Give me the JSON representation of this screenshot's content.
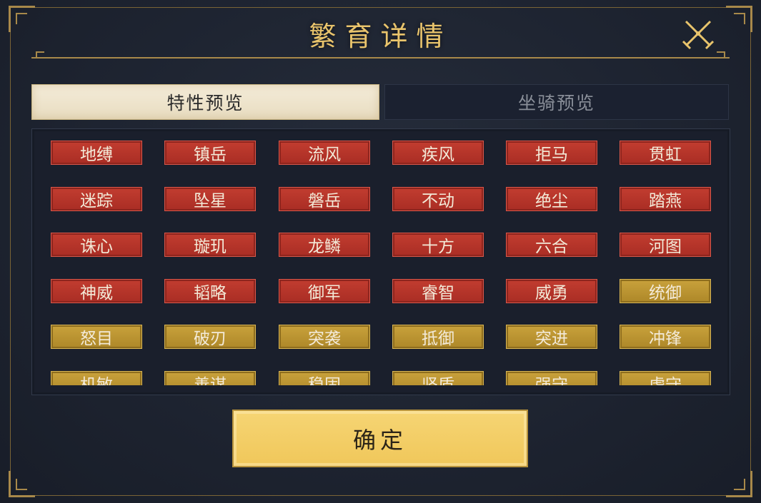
{
  "dialog": {
    "title": "繁育详情",
    "confirm_label": "确定"
  },
  "tabs": [
    {
      "label": "特性预览",
      "active": true
    },
    {
      "label": "坐骑预览",
      "active": false
    }
  ],
  "traits": [
    {
      "label": "地缚",
      "tier": "red"
    },
    {
      "label": "镇岳",
      "tier": "red"
    },
    {
      "label": "流风",
      "tier": "red"
    },
    {
      "label": "疾风",
      "tier": "red"
    },
    {
      "label": "拒马",
      "tier": "red"
    },
    {
      "label": "贯虹",
      "tier": "red"
    },
    {
      "label": "迷踪",
      "tier": "red"
    },
    {
      "label": "坠星",
      "tier": "red"
    },
    {
      "label": "磐岳",
      "tier": "red"
    },
    {
      "label": "不动",
      "tier": "red"
    },
    {
      "label": "绝尘",
      "tier": "red"
    },
    {
      "label": "踏燕",
      "tier": "red"
    },
    {
      "label": "诛心",
      "tier": "red"
    },
    {
      "label": "璇玑",
      "tier": "red"
    },
    {
      "label": "龙鳞",
      "tier": "red"
    },
    {
      "label": "十方",
      "tier": "red"
    },
    {
      "label": "六合",
      "tier": "red"
    },
    {
      "label": "河图",
      "tier": "red"
    },
    {
      "label": "神威",
      "tier": "red"
    },
    {
      "label": "韬略",
      "tier": "red"
    },
    {
      "label": "御军",
      "tier": "red"
    },
    {
      "label": "睿智",
      "tier": "red"
    },
    {
      "label": "威勇",
      "tier": "red"
    },
    {
      "label": "统御",
      "tier": "gold"
    },
    {
      "label": "怒目",
      "tier": "gold"
    },
    {
      "label": "破刃",
      "tier": "gold"
    },
    {
      "label": "突袭",
      "tier": "gold"
    },
    {
      "label": "抵御",
      "tier": "gold"
    },
    {
      "label": "突进",
      "tier": "gold"
    },
    {
      "label": "冲锋",
      "tier": "gold"
    },
    {
      "label": "机敏",
      "tier": "gold"
    },
    {
      "label": "善谋",
      "tier": "gold"
    },
    {
      "label": "稳固",
      "tier": "gold"
    },
    {
      "label": "坚盾",
      "tier": "gold"
    },
    {
      "label": "强守",
      "tier": "gold"
    },
    {
      "label": "虚守",
      "tier": "gold"
    }
  ],
  "colors": {
    "gold_accent": "#e9c46c",
    "trait_red": "#b83428",
    "trait_gold": "#bb9532",
    "confirm_bg": "#f2cb62"
  }
}
